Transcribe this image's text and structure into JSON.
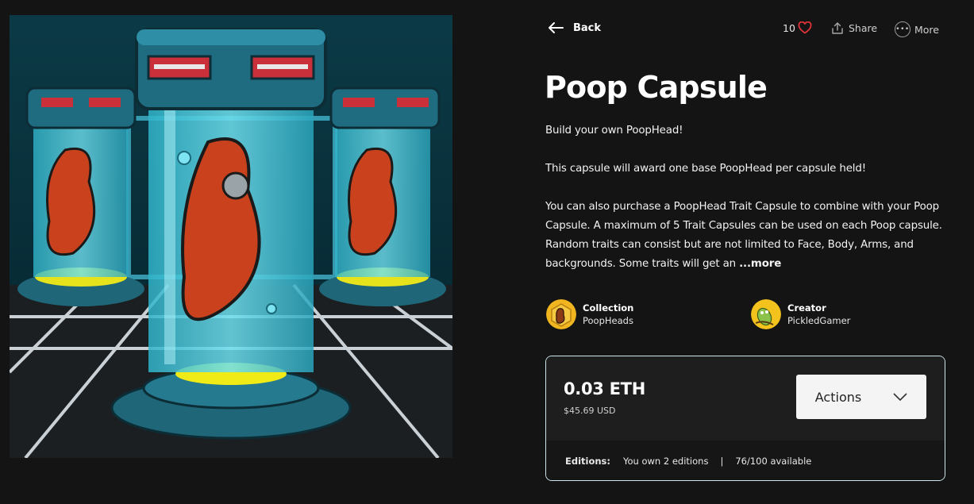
{
  "nav": {
    "back_label": "Back",
    "like_count": "10",
    "share_label": "Share",
    "more_label": "More"
  },
  "item": {
    "title": "Poop Capsule",
    "description": [
      "Build your own PoopHead!",
      "This capsule will award one base PoopHead per capsule held!",
      "You can also purchase a PoopHead Trait Capsule to combine with your Poop Capsule. A maximum of 5 Trait Capsules can be used on each Poop capsule. Random traits can consist but are not limited to Face, Body, Arms, and backgrounds. Some traits will get an"
    ],
    "more_link": "...more"
  },
  "collection": {
    "label": "Collection",
    "name": "PoopHeads"
  },
  "creator": {
    "label": "Creator",
    "name": "PickledGamer"
  },
  "listing": {
    "price": "0.03 ETH",
    "usd": "$45.69 USD",
    "actions_label": "Actions",
    "editions_label": "Editions:",
    "owned": "You own 2 editions",
    "separator": "|",
    "available": "76/100 available"
  },
  "colors": {
    "background": "#141414",
    "card_border": "#cfe6ee",
    "heart": "#e0343b",
    "capsule_glass": "#3fc6dc",
    "capsule_body": "#1f6c80"
  },
  "icons": [
    "back-arrow-icon",
    "heart-icon",
    "share-icon",
    "more-dots-icon",
    "chevron-down-icon"
  ]
}
